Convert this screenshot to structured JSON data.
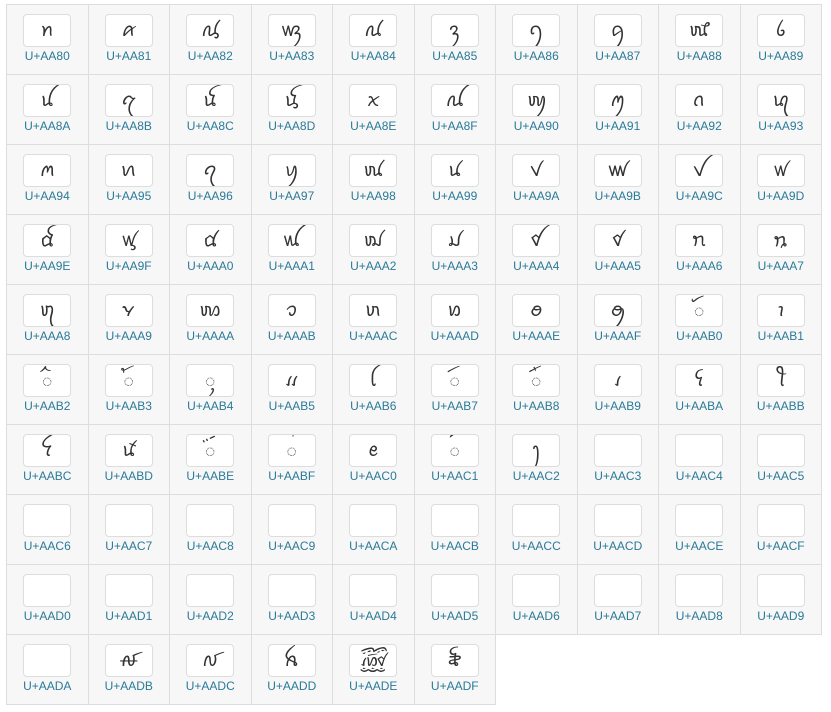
{
  "block_name": "Tai Viet",
  "chars": [
    {
      "code": "U+AA80",
      "ch": "ꪀ"
    },
    {
      "code": "U+AA81",
      "ch": "ꪁ"
    },
    {
      "code": "U+AA82",
      "ch": "ꪂ"
    },
    {
      "code": "U+AA83",
      "ch": "ꪃ"
    },
    {
      "code": "U+AA84",
      "ch": "ꪄ"
    },
    {
      "code": "U+AA85",
      "ch": "ꪅ"
    },
    {
      "code": "U+AA86",
      "ch": "ꪆ"
    },
    {
      "code": "U+AA87",
      "ch": "ꪇ"
    },
    {
      "code": "U+AA88",
      "ch": "ꪈ"
    },
    {
      "code": "U+AA89",
      "ch": "ꪉ"
    },
    {
      "code": "U+AA8A",
      "ch": "ꪊ"
    },
    {
      "code": "U+AA8B",
      "ch": "ꪋ"
    },
    {
      "code": "U+AA8C",
      "ch": "ꪌ"
    },
    {
      "code": "U+AA8D",
      "ch": "ꪍ"
    },
    {
      "code": "U+AA8E",
      "ch": "ꪎ"
    },
    {
      "code": "U+AA8F",
      "ch": "ꪏ"
    },
    {
      "code": "U+AA90",
      "ch": "ꪐ"
    },
    {
      "code": "U+AA91",
      "ch": "ꪑ"
    },
    {
      "code": "U+AA92",
      "ch": "ꪒ"
    },
    {
      "code": "U+AA93",
      "ch": "ꪓ"
    },
    {
      "code": "U+AA94",
      "ch": "ꪔ"
    },
    {
      "code": "U+AA95",
      "ch": "ꪕ"
    },
    {
      "code": "U+AA96",
      "ch": "ꪖ"
    },
    {
      "code": "U+AA97",
      "ch": "ꪗ"
    },
    {
      "code": "U+AA98",
      "ch": "ꪘ"
    },
    {
      "code": "U+AA99",
      "ch": "ꪙ"
    },
    {
      "code": "U+AA9A",
      "ch": "ꪚ"
    },
    {
      "code": "U+AA9B",
      "ch": "ꪛ"
    },
    {
      "code": "U+AA9C",
      "ch": "ꪜ"
    },
    {
      "code": "U+AA9D",
      "ch": "ꪝ"
    },
    {
      "code": "U+AA9E",
      "ch": "ꪞ"
    },
    {
      "code": "U+AA9F",
      "ch": "ꪟ"
    },
    {
      "code": "U+AAA0",
      "ch": "ꪠ"
    },
    {
      "code": "U+AAA1",
      "ch": "ꪡ"
    },
    {
      "code": "U+AAA2",
      "ch": "ꪢ"
    },
    {
      "code": "U+AAA3",
      "ch": "ꪣ"
    },
    {
      "code": "U+AAA4",
      "ch": "ꪤ"
    },
    {
      "code": "U+AAA5",
      "ch": "ꪥ"
    },
    {
      "code": "U+AAA6",
      "ch": "ꪦ"
    },
    {
      "code": "U+AAA7",
      "ch": "ꪧ"
    },
    {
      "code": "U+AAA8",
      "ch": "ꪨ"
    },
    {
      "code": "U+AAA9",
      "ch": "ꪩ"
    },
    {
      "code": "U+AAAA",
      "ch": "ꪪ"
    },
    {
      "code": "U+AAAB",
      "ch": "ꪫ"
    },
    {
      "code": "U+AAAC",
      "ch": "ꪬ"
    },
    {
      "code": "U+AAAD",
      "ch": "ꪭ"
    },
    {
      "code": "U+AAAE",
      "ch": "ꪮ"
    },
    {
      "code": "U+AAAF",
      "ch": "ꪯ"
    },
    {
      "code": "U+AAB0",
      "ch": "ꪰ"
    },
    {
      "code": "U+AAB1",
      "ch": "ꪱ"
    },
    {
      "code": "U+AAB2",
      "ch": "ꪲ"
    },
    {
      "code": "U+AAB3",
      "ch": "ꪳ"
    },
    {
      "code": "U+AAB4",
      "ch": "ꪴ"
    },
    {
      "code": "U+AAB5",
      "ch": "ꪵ"
    },
    {
      "code": "U+AAB6",
      "ch": "ꪶ"
    },
    {
      "code": "U+AAB7",
      "ch": "ꪷ"
    },
    {
      "code": "U+AAB8",
      "ch": "ꪸ"
    },
    {
      "code": "U+AAB9",
      "ch": "ꪹ"
    },
    {
      "code": "U+AABA",
      "ch": "ꪺ"
    },
    {
      "code": "U+AABB",
      "ch": "ꪻ"
    },
    {
      "code": "U+AABC",
      "ch": "ꪼ"
    },
    {
      "code": "U+AABD",
      "ch": "ꪽ"
    },
    {
      "code": "U+AABE",
      "ch": "ꪾ"
    },
    {
      "code": "U+AABF",
      "ch": "꪿"
    },
    {
      "code": "U+AAC0",
      "ch": "ꫀ"
    },
    {
      "code": "U+AAC1",
      "ch": "꫁"
    },
    {
      "code": "U+AAC2",
      "ch": "ꫂ"
    },
    {
      "code": "U+AAC3",
      "ch": ""
    },
    {
      "code": "U+AAC4",
      "ch": ""
    },
    {
      "code": "U+AAC5",
      "ch": ""
    },
    {
      "code": "U+AAC6",
      "ch": ""
    },
    {
      "code": "U+AAC7",
      "ch": ""
    },
    {
      "code": "U+AAC8",
      "ch": ""
    },
    {
      "code": "U+AAC9",
      "ch": ""
    },
    {
      "code": "U+AACA",
      "ch": ""
    },
    {
      "code": "U+AACB",
      "ch": ""
    },
    {
      "code": "U+AACC",
      "ch": ""
    },
    {
      "code": "U+AACD",
      "ch": ""
    },
    {
      "code": "U+AACE",
      "ch": ""
    },
    {
      "code": "U+AACF",
      "ch": ""
    },
    {
      "code": "U+AAD0",
      "ch": ""
    },
    {
      "code": "U+AAD1",
      "ch": ""
    },
    {
      "code": "U+AAD2",
      "ch": ""
    },
    {
      "code": "U+AAD3",
      "ch": ""
    },
    {
      "code": "U+AAD4",
      "ch": ""
    },
    {
      "code": "U+AAD5",
      "ch": ""
    },
    {
      "code": "U+AAD6",
      "ch": ""
    },
    {
      "code": "U+AAD7",
      "ch": ""
    },
    {
      "code": "U+AAD8",
      "ch": ""
    },
    {
      "code": "U+AAD9",
      "ch": ""
    },
    {
      "code": "U+AADA",
      "ch": ""
    },
    {
      "code": "U+AADB",
      "ch": "ꫛ"
    },
    {
      "code": "U+AADC",
      "ch": "ꫜ"
    },
    {
      "code": "U+AADD",
      "ch": "ꫝ"
    },
    {
      "code": "U+AADE",
      "ch": "꫞"
    },
    {
      "code": "U+AADF",
      "ch": "꫟"
    }
  ]
}
